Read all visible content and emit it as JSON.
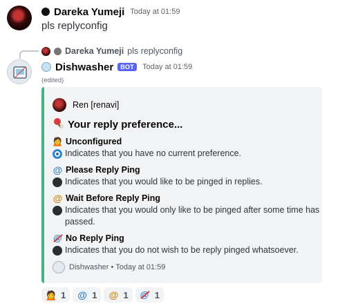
{
  "message1": {
    "username": "Dareka Yumeji",
    "timestamp": "Today at 01:59",
    "text": "pls replyconfig"
  },
  "reply_reference": {
    "username": "Dareka Yumeji",
    "text": "pls replyconfig"
  },
  "message2": {
    "username": "Dishwasher",
    "bot_tag": "BOT",
    "timestamp": "Today at 01:59",
    "edited": "(edited)"
  },
  "embed": {
    "accent_color": "#43b581",
    "author": "Ren [renavi]",
    "title": "Your reply preference...",
    "sections": [
      {
        "icon": "person-emoji",
        "heading": "Unconfigured",
        "description": "Indicates that you have no current preference.",
        "selected": true
      },
      {
        "icon": "at-sign-icon",
        "heading": "Please Reply Ping",
        "description": "Indicates that you would like to be pinged in replies.",
        "selected": false
      },
      {
        "icon": "at-sign-clock-icon",
        "heading": "Wait Before Reply Ping",
        "description": "Indicates that you would only like to be pinged after some time has passed.",
        "selected": false
      },
      {
        "icon": "no-at-sign-icon",
        "heading": "No Reply Ping",
        "description": "Indicates that you do not wish to be reply pinged whatsoever.",
        "selected": false
      }
    ],
    "footer": "Dishwasher • Today at 01:59"
  },
  "reactions": [
    {
      "emoji": "person-emoji",
      "count": "1"
    },
    {
      "emoji": "at-sign-icon",
      "count": "1"
    },
    {
      "emoji": "at-sign-clock-icon",
      "count": "1"
    },
    {
      "emoji": "no-at-sign-icon",
      "count": "1"
    }
  ],
  "colors": {
    "bot_tag": "#5865f2",
    "selected_radio": "#1e6fb5",
    "unselected_radio": "#2b2d31"
  }
}
